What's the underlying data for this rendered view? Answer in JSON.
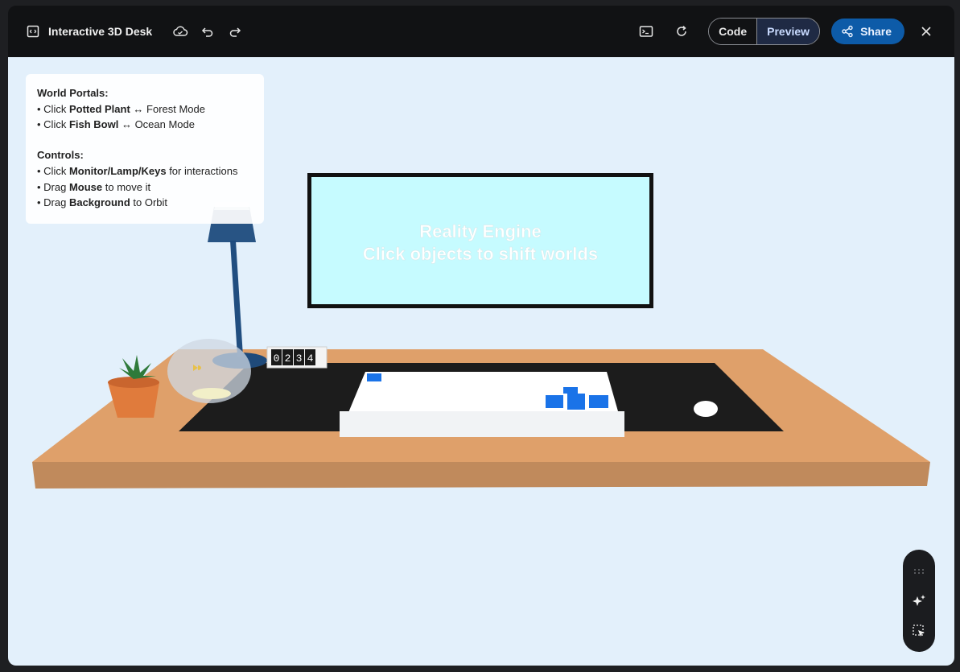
{
  "app": {
    "title": "Interactive 3D Desk"
  },
  "toolbar": {
    "code_label": "Code",
    "preview_label": "Preview",
    "share_label": "Share"
  },
  "scene": {
    "monitor_line1": "Reality Engine",
    "monitor_line2": "Click objects to shift worlds",
    "counter_digits": [
      "0",
      "2",
      "3",
      "4"
    ]
  },
  "info_panel": {
    "portals_heading": "World Portals:",
    "portal_items": [
      {
        "prefix": "• Click ",
        "bold": "Potted Plant",
        "suffix": " ↔ Forest Mode"
      },
      {
        "prefix": "• Click ",
        "bold": "Fish Bowl",
        "suffix": " ↔ Ocean Mode"
      }
    ],
    "controls_heading": "Controls:",
    "control_items": [
      {
        "prefix": "• Click ",
        "bold": "Monitor/Lamp/Keys",
        "suffix": " for interactions"
      },
      {
        "prefix": "• Drag ",
        "bold": "Mouse",
        "suffix": " to move it"
      },
      {
        "prefix": "• Drag ",
        "bold": "Background",
        "suffix": " to Orbit"
      }
    ]
  },
  "colors": {
    "accent": "#0d5ba8",
    "background": "#e3f0fb",
    "desk": "#dfa06a",
    "monitor_screen": "#c6fbff"
  }
}
